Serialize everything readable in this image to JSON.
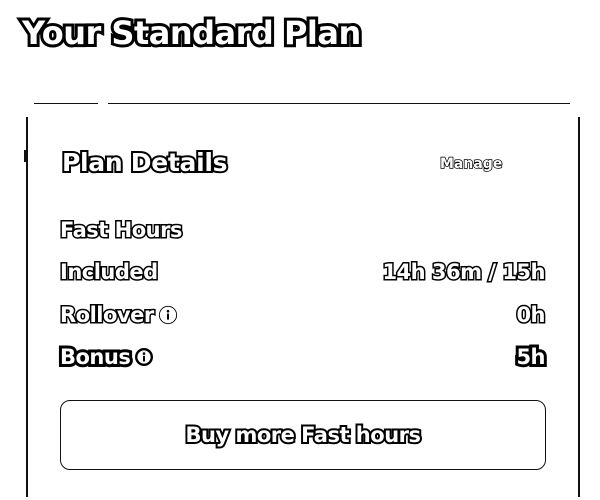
{
  "page": {
    "title": "Your Standard Plan"
  },
  "card": {
    "title": "Plan Details",
    "manage_label": "Manage",
    "section_label": "Fast Hours",
    "rows": [
      {
        "label": "Included",
        "value": "14h 36m / 15h",
        "has_info_icon": false
      },
      {
        "label": "Rollover",
        "value": "0h",
        "has_info_icon": true,
        "icon": "info-icon"
      },
      {
        "label": "Bonus",
        "value": "5h",
        "has_info_icon": true,
        "icon": "info-icon"
      }
    ],
    "buy_button_label": "Buy more Fast hours"
  },
  "colors": {
    "text_fill": "#ffffff",
    "text_stroke": "#000000",
    "border": "#111111",
    "background": "#ffffff"
  }
}
